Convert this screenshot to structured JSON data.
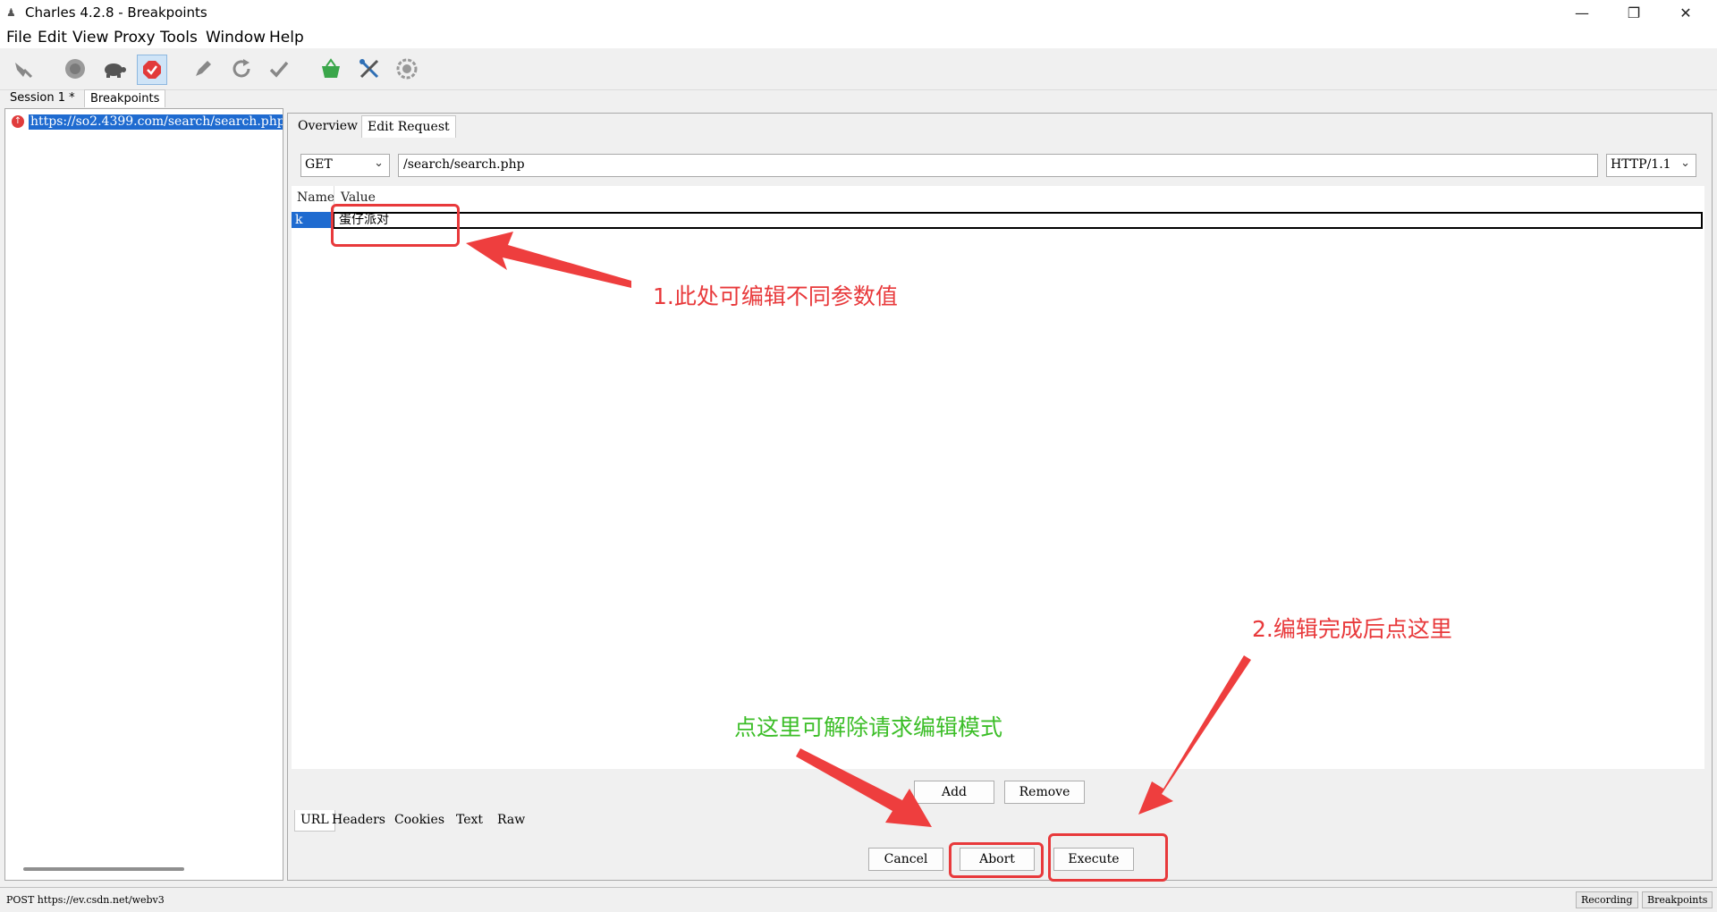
{
  "window": {
    "title": "Charles 4.2.8 - Breakpoints",
    "minimize_glyph": "—",
    "restore_glyph": "❐",
    "close_glyph": "✕"
  },
  "menu": [
    "File",
    "Edit",
    "View",
    "Proxy",
    "Tools",
    "Window",
    "Help"
  ],
  "toolbar_icons": [
    "broom-icon",
    "record-icon",
    "turtle-icon",
    "breakpoints-icon",
    "pen-icon",
    "repeat-icon",
    "validate-icon",
    "basket-icon",
    "tools-icon",
    "settings-icon"
  ],
  "session_tabs": {
    "session": "Session 1 *",
    "breakpoints": "Breakpoints"
  },
  "tree": {
    "selected_item": "https://so2.4399.com/search/search.php"
  },
  "editor_tabs": {
    "overview": "Overview",
    "edit_request": "Edit Request"
  },
  "request": {
    "method": "GET",
    "path": "/search/search.php",
    "protocol": "HTTP/1.1"
  },
  "params": {
    "col_name": "Name",
    "col_value": "Value",
    "rows": [
      {
        "name": "k",
        "value": "蛋仔派对"
      }
    ]
  },
  "param_buttons": {
    "add": "Add",
    "remove": "Remove"
  },
  "bottom_tabs": [
    "URL",
    "Headers",
    "Cookies",
    "Text",
    "Raw"
  ],
  "actions": {
    "cancel": "Cancel",
    "abort": "Abort",
    "execute": "Execute"
  },
  "status": {
    "text": "POST https://ev.csdn.net/webv3",
    "recording": "Recording",
    "breakpoints": "Breakpoints"
  },
  "annotations": {
    "note1": "1.此处可编辑不同参数值",
    "note2": "2.编辑完成后点这里",
    "note3": "点这里可解除请求编辑模式",
    "red": "#e8393b",
    "green": "#3cbe28"
  }
}
